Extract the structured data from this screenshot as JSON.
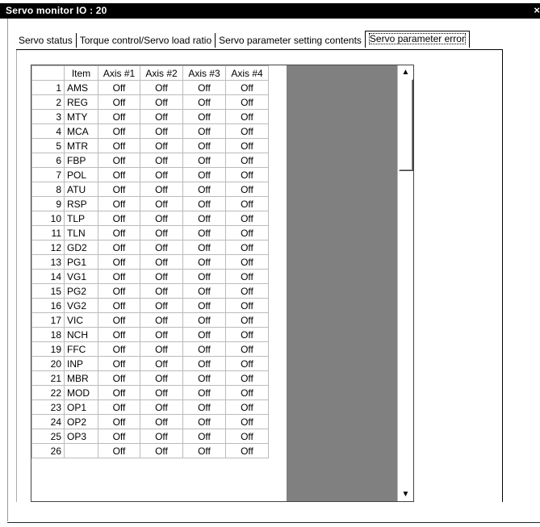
{
  "window": {
    "title": "Servo monitor IO : 20",
    "close_label": "×"
  },
  "tabs": [
    {
      "label": "Servo status"
    },
    {
      "label": "Torque control/Servo load ratio"
    },
    {
      "label": "Servo parameter setting contents"
    },
    {
      "label": "Servo parameter error",
      "active": true
    }
  ],
  "table": {
    "columns": [
      "",
      "Item",
      "Axis #1",
      "Axis #2",
      "Axis #3",
      "Axis #4"
    ],
    "rows": [
      {
        "num": "1",
        "item": "AMS",
        "v": [
          "Off",
          "Off",
          "Off",
          "Off"
        ]
      },
      {
        "num": "2",
        "item": "REG",
        "v": [
          "Off",
          "Off",
          "Off",
          "Off"
        ]
      },
      {
        "num": "3",
        "item": "MTY",
        "v": [
          "Off",
          "Off",
          "Off",
          "Off"
        ]
      },
      {
        "num": "4",
        "item": "MCA",
        "v": [
          "Off",
          "Off",
          "Off",
          "Off"
        ]
      },
      {
        "num": "5",
        "item": "MTR",
        "v": [
          "Off",
          "Off",
          "Off",
          "Off"
        ]
      },
      {
        "num": "6",
        "item": "FBP",
        "v": [
          "Off",
          "Off",
          "Off",
          "Off"
        ]
      },
      {
        "num": "7",
        "item": "POL",
        "v": [
          "Off",
          "Off",
          "Off",
          "Off"
        ]
      },
      {
        "num": "8",
        "item": "ATU",
        "v": [
          "Off",
          "Off",
          "Off",
          "Off"
        ]
      },
      {
        "num": "9",
        "item": "RSP",
        "v": [
          "Off",
          "Off",
          "Off",
          "Off"
        ]
      },
      {
        "num": "10",
        "item": "TLP",
        "v": [
          "Off",
          "Off",
          "Off",
          "Off"
        ]
      },
      {
        "num": "11",
        "item": "TLN",
        "v": [
          "Off",
          "Off",
          "Off",
          "Off"
        ]
      },
      {
        "num": "12",
        "item": "GD2",
        "v": [
          "Off",
          "Off",
          "Off",
          "Off"
        ]
      },
      {
        "num": "13",
        "item": "PG1",
        "v": [
          "Off",
          "Off",
          "Off",
          "Off"
        ]
      },
      {
        "num": "14",
        "item": "VG1",
        "v": [
          "Off",
          "Off",
          "Off",
          "Off"
        ]
      },
      {
        "num": "15",
        "item": "PG2",
        "v": [
          "Off",
          "Off",
          "Off",
          "Off"
        ]
      },
      {
        "num": "16",
        "item": "VG2",
        "v": [
          "Off",
          "Off",
          "Off",
          "Off"
        ]
      },
      {
        "num": "17",
        "item": "VIC",
        "v": [
          "Off",
          "Off",
          "Off",
          "Off"
        ]
      },
      {
        "num": "18",
        "item": "NCH",
        "v": [
          "Off",
          "Off",
          "Off",
          "Off"
        ]
      },
      {
        "num": "19",
        "item": "FFC",
        "v": [
          "Off",
          "Off",
          "Off",
          "Off"
        ]
      },
      {
        "num": "20",
        "item": "INP",
        "v": [
          "Off",
          "Off",
          "Off",
          "Off"
        ]
      },
      {
        "num": "21",
        "item": "MBR",
        "v": [
          "Off",
          "Off",
          "Off",
          "Off"
        ]
      },
      {
        "num": "22",
        "item": "MOD",
        "v": [
          "Off",
          "Off",
          "Off",
          "Off"
        ]
      },
      {
        "num": "23",
        "item": "OP1",
        "v": [
          "Off",
          "Off",
          "Off",
          "Off"
        ]
      },
      {
        "num": "24",
        "item": "OP2",
        "v": [
          "Off",
          "Off",
          "Off",
          "Off"
        ]
      },
      {
        "num": "25",
        "item": "OP3",
        "v": [
          "Off",
          "Off",
          "Off",
          "Off"
        ]
      },
      {
        "num": "26",
        "item": "",
        "v": [
          "Off",
          "Off",
          "Off",
          "Off"
        ]
      }
    ]
  },
  "scrollbar": {
    "up_icon": "arrow-up-icon",
    "down_icon": "arrow-down-icon",
    "up_glyph": "▲",
    "down_glyph": "▼"
  }
}
